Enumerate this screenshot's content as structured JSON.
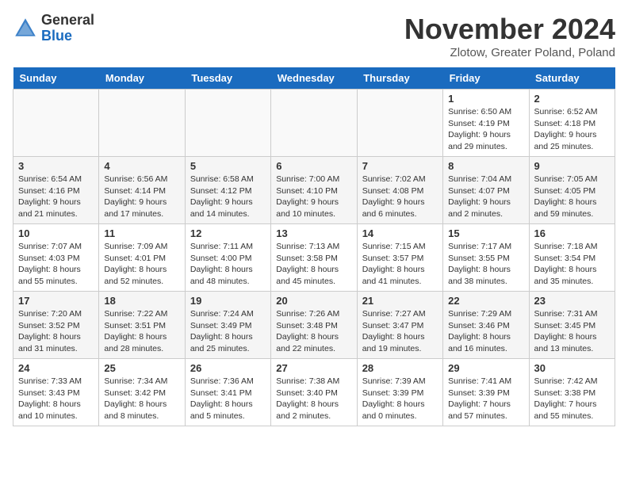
{
  "header": {
    "logo_general": "General",
    "logo_blue": "Blue",
    "title": "November 2024",
    "subtitle": "Zlotow, Greater Poland, Poland"
  },
  "days_of_week": [
    "Sunday",
    "Monday",
    "Tuesday",
    "Wednesday",
    "Thursday",
    "Friday",
    "Saturday"
  ],
  "weeks": [
    [
      {
        "day": "",
        "info": ""
      },
      {
        "day": "",
        "info": ""
      },
      {
        "day": "",
        "info": ""
      },
      {
        "day": "",
        "info": ""
      },
      {
        "day": "",
        "info": ""
      },
      {
        "day": "1",
        "info": "Sunrise: 6:50 AM\nSunset: 4:19 PM\nDaylight: 9 hours\nand 29 minutes."
      },
      {
        "day": "2",
        "info": "Sunrise: 6:52 AM\nSunset: 4:18 PM\nDaylight: 9 hours\nand 25 minutes."
      }
    ],
    [
      {
        "day": "3",
        "info": "Sunrise: 6:54 AM\nSunset: 4:16 PM\nDaylight: 9 hours\nand 21 minutes."
      },
      {
        "day": "4",
        "info": "Sunrise: 6:56 AM\nSunset: 4:14 PM\nDaylight: 9 hours\nand 17 minutes."
      },
      {
        "day": "5",
        "info": "Sunrise: 6:58 AM\nSunset: 4:12 PM\nDaylight: 9 hours\nand 14 minutes."
      },
      {
        "day": "6",
        "info": "Sunrise: 7:00 AM\nSunset: 4:10 PM\nDaylight: 9 hours\nand 10 minutes."
      },
      {
        "day": "7",
        "info": "Sunrise: 7:02 AM\nSunset: 4:08 PM\nDaylight: 9 hours\nand 6 minutes."
      },
      {
        "day": "8",
        "info": "Sunrise: 7:04 AM\nSunset: 4:07 PM\nDaylight: 9 hours\nand 2 minutes."
      },
      {
        "day": "9",
        "info": "Sunrise: 7:05 AM\nSunset: 4:05 PM\nDaylight: 8 hours\nand 59 minutes."
      }
    ],
    [
      {
        "day": "10",
        "info": "Sunrise: 7:07 AM\nSunset: 4:03 PM\nDaylight: 8 hours\nand 55 minutes."
      },
      {
        "day": "11",
        "info": "Sunrise: 7:09 AM\nSunset: 4:01 PM\nDaylight: 8 hours\nand 52 minutes."
      },
      {
        "day": "12",
        "info": "Sunrise: 7:11 AM\nSunset: 4:00 PM\nDaylight: 8 hours\nand 48 minutes."
      },
      {
        "day": "13",
        "info": "Sunrise: 7:13 AM\nSunset: 3:58 PM\nDaylight: 8 hours\nand 45 minutes."
      },
      {
        "day": "14",
        "info": "Sunrise: 7:15 AM\nSunset: 3:57 PM\nDaylight: 8 hours\nand 41 minutes."
      },
      {
        "day": "15",
        "info": "Sunrise: 7:17 AM\nSunset: 3:55 PM\nDaylight: 8 hours\nand 38 minutes."
      },
      {
        "day": "16",
        "info": "Sunrise: 7:18 AM\nSunset: 3:54 PM\nDaylight: 8 hours\nand 35 minutes."
      }
    ],
    [
      {
        "day": "17",
        "info": "Sunrise: 7:20 AM\nSunset: 3:52 PM\nDaylight: 8 hours\nand 31 minutes."
      },
      {
        "day": "18",
        "info": "Sunrise: 7:22 AM\nSunset: 3:51 PM\nDaylight: 8 hours\nand 28 minutes."
      },
      {
        "day": "19",
        "info": "Sunrise: 7:24 AM\nSunset: 3:49 PM\nDaylight: 8 hours\nand 25 minutes."
      },
      {
        "day": "20",
        "info": "Sunrise: 7:26 AM\nSunset: 3:48 PM\nDaylight: 8 hours\nand 22 minutes."
      },
      {
        "day": "21",
        "info": "Sunrise: 7:27 AM\nSunset: 3:47 PM\nDaylight: 8 hours\nand 19 minutes."
      },
      {
        "day": "22",
        "info": "Sunrise: 7:29 AM\nSunset: 3:46 PM\nDaylight: 8 hours\nand 16 minutes."
      },
      {
        "day": "23",
        "info": "Sunrise: 7:31 AM\nSunset: 3:45 PM\nDaylight: 8 hours\nand 13 minutes."
      }
    ],
    [
      {
        "day": "24",
        "info": "Sunrise: 7:33 AM\nSunset: 3:43 PM\nDaylight: 8 hours\nand 10 minutes."
      },
      {
        "day": "25",
        "info": "Sunrise: 7:34 AM\nSunset: 3:42 PM\nDaylight: 8 hours\nand 8 minutes."
      },
      {
        "day": "26",
        "info": "Sunrise: 7:36 AM\nSunset: 3:41 PM\nDaylight: 8 hours\nand 5 minutes."
      },
      {
        "day": "27",
        "info": "Sunrise: 7:38 AM\nSunset: 3:40 PM\nDaylight: 8 hours\nand 2 minutes."
      },
      {
        "day": "28",
        "info": "Sunrise: 7:39 AM\nSunset: 3:39 PM\nDaylight: 8 hours\nand 0 minutes."
      },
      {
        "day": "29",
        "info": "Sunrise: 7:41 AM\nSunset: 3:39 PM\nDaylight: 7 hours\nand 57 minutes."
      },
      {
        "day": "30",
        "info": "Sunrise: 7:42 AM\nSunset: 3:38 PM\nDaylight: 7 hours\nand 55 minutes."
      }
    ]
  ]
}
